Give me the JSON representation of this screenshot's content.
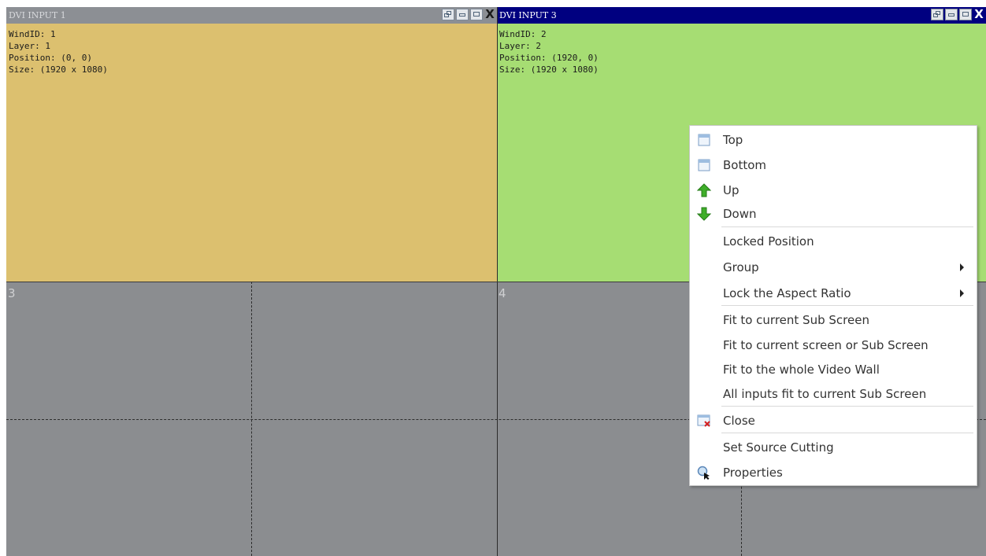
{
  "colors": {
    "screen_gray": "#8b8d90",
    "window1_body": "#dcc06f",
    "window1_title": "#8c8f94",
    "window2_body": "#a6dd73",
    "window2_title": "#000080"
  },
  "cells": {
    "c3": "3",
    "c4": "4"
  },
  "windows": [
    {
      "title": "DVI INPUT 1",
      "active": false,
      "info": [
        "WindID: 1",
        "Layer: 1",
        "Position: (0, 0)",
        "Size: (1920 x 1080)"
      ],
      "buttons": [
        "restore-icon",
        "minimize-icon",
        "maximize-icon",
        "close-icon"
      ]
    },
    {
      "title": "DVI INPUT 3",
      "active": true,
      "info": [
        "WindID: 2",
        "Layer: 2",
        "Position: (1920, 0)",
        "Size: (1920 x 1080)"
      ],
      "buttons": [
        "restore-icon",
        "minimize-icon",
        "maximize-icon",
        "close-icon"
      ]
    }
  ],
  "window_close_glyph": "X",
  "context_menu": {
    "items": [
      {
        "label": "Top",
        "icon": "window-top-icon"
      },
      {
        "label": "Bottom",
        "icon": "window-bottom-icon"
      },
      {
        "label": "Up",
        "icon": "arrow-up-icon"
      },
      {
        "label": "Down",
        "icon": "arrow-down-icon"
      },
      {
        "label": "Locked Position"
      },
      {
        "label": "Group",
        "submenu": true
      },
      {
        "label": "Lock the Aspect Ratio",
        "submenu": true
      },
      {
        "label": "Fit to current Sub Screen"
      },
      {
        "label": "Fit to current screen or Sub Screen"
      },
      {
        "label": "Fit to the whole Video Wall"
      },
      {
        "label": "All inputs fit to current Sub Screen"
      },
      {
        "label": "Close",
        "icon": "close-window-icon"
      },
      {
        "label": "Set Source Cutting"
      },
      {
        "label": "Properties",
        "icon": "properties-icon"
      }
    ]
  }
}
